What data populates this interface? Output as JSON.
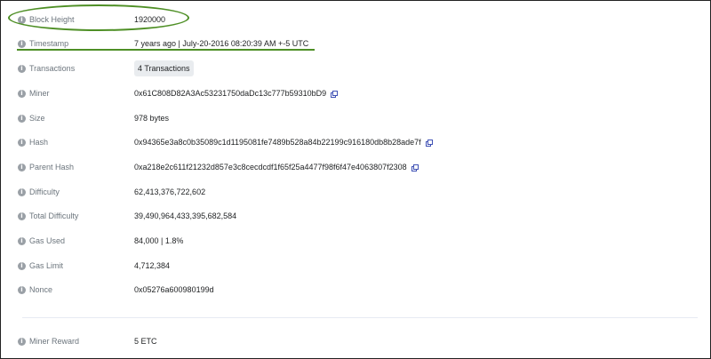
{
  "block": {
    "height": {
      "label": "Block Height",
      "value": "1920000"
    },
    "timestamp": {
      "label": "Timestamp",
      "value": "7 years ago | July-20-2016 08:20:39 AM +-5 UTC"
    },
    "transactions": {
      "label": "Transactions",
      "value": "4 Transactions"
    },
    "miner": {
      "label": "Miner",
      "value": "0x61C808D82A3Ac53231750daDc13c777b59310bD9"
    },
    "size": {
      "label": "Size",
      "value": "978 bytes"
    },
    "hash": {
      "label": "Hash",
      "value": "0x94365e3a8c0b35089c1d1195081fe7489b528a84b22199c916180db8b28ade7f"
    },
    "parent_hash": {
      "label": "Parent Hash",
      "value": "0xa218e2c611f21232d857e3c8cecdcdf1f65f25a4477f98f6f47e4063807f2308"
    },
    "difficulty": {
      "label": "Difficulty",
      "value": "62,413,376,722,602"
    },
    "total_difficulty": {
      "label": "Total Difficulty",
      "value": "39,490,964,433,395,682,584"
    },
    "gas_used": {
      "label": "Gas Used",
      "value": "84,000 | 1.8%"
    },
    "gas_limit": {
      "label": "Gas Limit",
      "value": "4,712,384"
    },
    "nonce": {
      "label": "Nonce",
      "value": "0x05276a600980199d"
    },
    "miner_reward": {
      "label": "Miner Reward",
      "value": "5 ETC"
    }
  },
  "icons": {
    "info": "info-circle-icon",
    "copy": "copy-icon"
  },
  "colors": {
    "highlight": "#4e8f25",
    "link": "#3f51b5",
    "label": "#6c757d"
  }
}
